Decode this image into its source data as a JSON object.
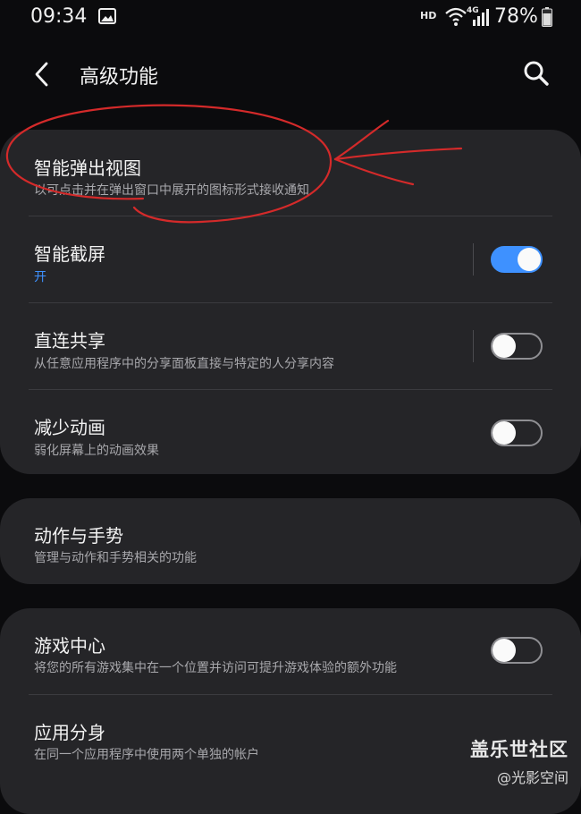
{
  "status_bar": {
    "time": "09:34",
    "hd": "HD",
    "network": "4G",
    "battery": "78%"
  },
  "app_bar": {
    "title": "高级功能"
  },
  "section1": {
    "items": [
      {
        "title": "智能弹出视图",
        "subtitle": "以可点击并在弹出窗口中展开的图标形式接收通知"
      },
      {
        "title": "智能截屏",
        "subtitle": "开",
        "toggle": true
      },
      {
        "title": "直连共享",
        "subtitle": "从任意应用程序中的分享面板直接与特定的人分享内容",
        "toggle": false
      },
      {
        "title": "减少动画",
        "subtitle": "弱化屏幕上的动画效果",
        "toggle": false
      }
    ]
  },
  "section2": {
    "items": [
      {
        "title": "动作与手势",
        "subtitle": "管理与动作和手势相关的功能"
      }
    ]
  },
  "section3": {
    "items": [
      {
        "title": "游戏中心",
        "subtitle": "将您的所有游戏集中在一个位置并访问可提升游戏体验的额外功能",
        "toggle": false
      },
      {
        "title": "应用分身",
        "subtitle": "在同一个应用程序中使用两个单独的帐户"
      }
    ]
  },
  "watermark": {
    "line1": "盖乐世社区",
    "line2": "@光影空间"
  },
  "colors": {
    "accent": "#3e91ff",
    "card": "#252528",
    "background": "#0b0b0d",
    "annotation": "#d42a2a"
  }
}
